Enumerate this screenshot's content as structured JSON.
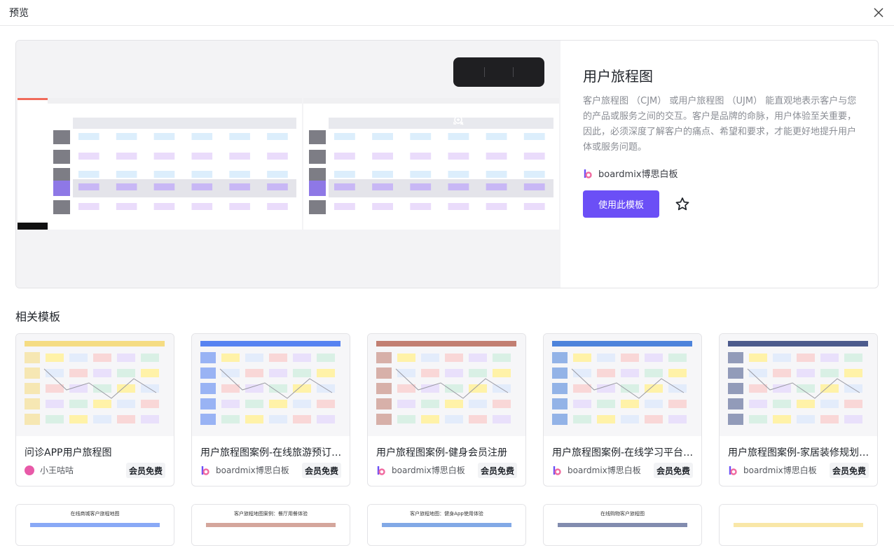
{
  "dialog": {
    "title": "预览"
  },
  "template": {
    "title": "用户旅程图",
    "description": "客户旅程图 （CJM） 或用户旅程图 （UJM） 能直观地表示客户与您的产品或服务之间的交互。客户是品牌的命脉，用户体验至关重要，因此，必须深度了解客户的痛点、希望和要求，才能更好地提升用户体或服务问题。",
    "author": "boardmix博思白板",
    "use_button": "使用此模板",
    "accent": "#6b4ff6"
  },
  "zoom_controls": [
    "zoom-in-icon",
    "zoom-out-icon",
    "fullscreen-icon"
  ],
  "related": {
    "heading": "相关模板",
    "cards": [
      {
        "title": "问诊APP用户旅程图",
        "author": "小王咕咕",
        "badge": "会员免费"
      },
      {
        "title": "用户旅程图案例-在线旅游预订平台",
        "author": "boardmix博思白板",
        "badge": "会员免费"
      },
      {
        "title": "用户旅程图案例-健身会员注册",
        "author": "boardmix博思白板",
        "badge": "会员免费"
      },
      {
        "title": "用户旅程图案例-在线学习平台使用",
        "author": "boardmix博思白板",
        "badge": "会员免费"
      },
      {
        "title": "用户旅程图案例-家居装修规划App",
        "author": "boardmix博思白板",
        "badge": "会员免费"
      }
    ],
    "second_row_titles": [
      "在线商城客户旅程地图",
      "客户旅程地图案例：餐厅用餐体验",
      "客户旅程地图：健身App使用体验",
      "在线购物客户旅程图",
      ""
    ]
  }
}
